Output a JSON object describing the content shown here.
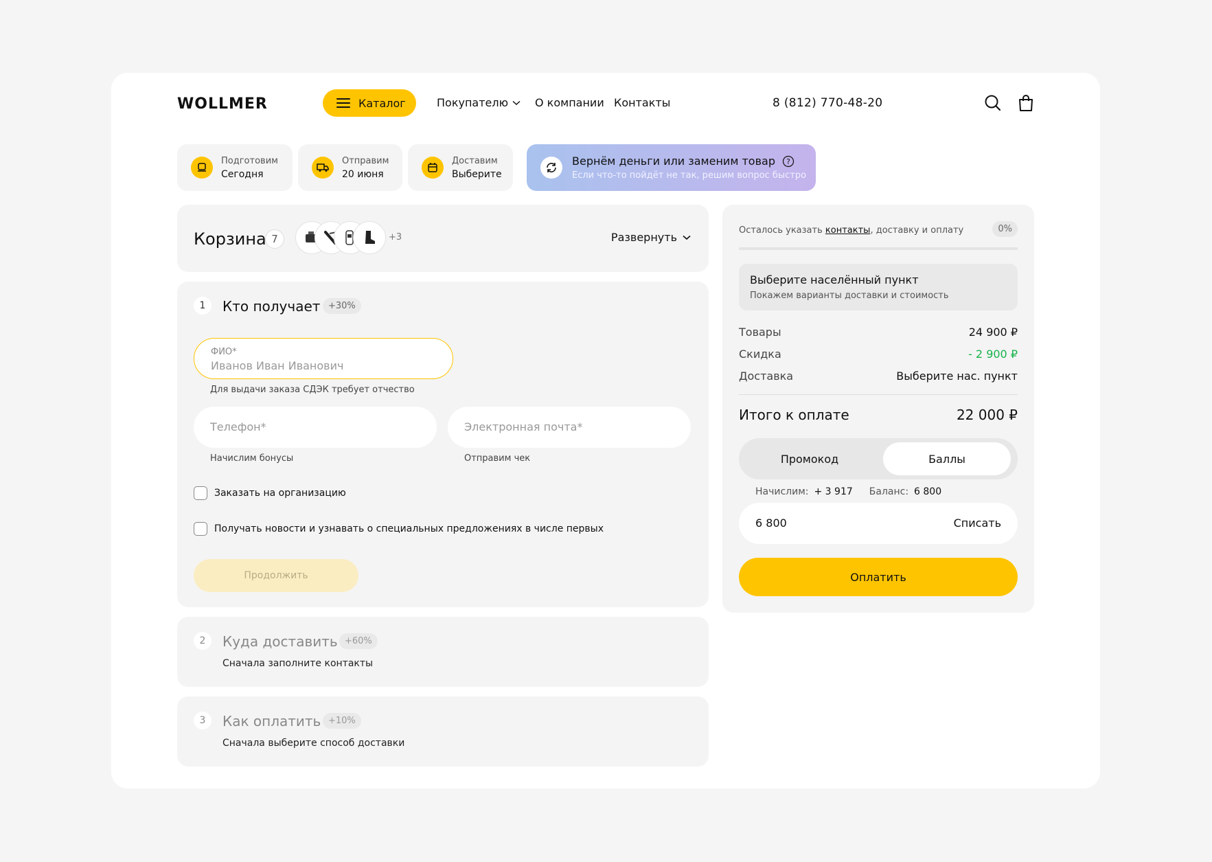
{
  "header": {
    "logo": "WOLLMER",
    "catalog_label": "Каталог",
    "nav": [
      "Покупателю",
      "О компании",
      "Контакты"
    ],
    "phone": "8 (812) 770-48-20",
    "icons": [
      "search-icon",
      "bag-icon"
    ]
  },
  "info_pills": [
    {
      "label": "Подготовим",
      "value": "Сегодня"
    },
    {
      "label": "Отправим",
      "value": "20 июня"
    },
    {
      "label": "Доставим",
      "value": "Выберите"
    }
  ],
  "refund": {
    "title": "Вернём деньги или заменим товар",
    "subtitle": "Если что-то пойдёт не так, решим вопрос быстро"
  },
  "cart": {
    "title": "Корзина",
    "count": "7",
    "more": "+3",
    "expand_label": "Развернуть"
  },
  "step1": {
    "number": "1",
    "title": "Кто получает",
    "badge": "+30%",
    "fio_label": "ФИО*",
    "fio_placeholder": "Иванов Иван Иванович",
    "fio_hint": "Для выдачи заказа СДЭК требует отчество",
    "phone_placeholder": "Телефон*",
    "phone_hint": "Начислим бонусы",
    "email_placeholder": "Электронная почта*",
    "email_hint": "Отправим чек",
    "check_org": "Заказать на организацию",
    "check_news": "Получать новости и узнавать о специальных предложениях в числе первых",
    "continue_label": "Продолжить"
  },
  "step2": {
    "number": "2",
    "title": "Куда доставить",
    "badge": "+60%",
    "subtitle": "Сначала заполните контакты"
  },
  "step3": {
    "number": "3",
    "title": "Как оплатить",
    "badge": "+10%",
    "subtitle": "Сначала выберите способ доставки"
  },
  "summary": {
    "progress_prefix": "Осталось указать ",
    "progress_link": "контакты",
    "progress_suffix": ", доставку и оплату",
    "progress_pct": "0%",
    "progress_value": 0,
    "city_title": "Выберите населённый пункт",
    "city_subtitle": "Покажем варианты доставки и стоимость",
    "goods_label": "Товары",
    "goods_value": "24 900 ₽",
    "discount_label": "Скидка",
    "discount_value": "- 2 900 ₽",
    "delivery_label": "Доставка",
    "delivery_value": "Выберите нас. пункт",
    "total_label": "Итого к оплате",
    "total_value": "22 000 ₽",
    "tab_promo": "Промокод",
    "tab_points": "Баллы",
    "accrue_label": "Начислим:",
    "accrue_value": "+ 3 917",
    "balance_label": "Баланс:",
    "balance_value": "6 800",
    "points_value": "6 800",
    "writeoff_label": "Списать",
    "pay_label": "Оплатить"
  },
  "colors": {
    "accent": "#ffc400",
    "discount": "#17b24a",
    "panel": "#f4f4f4"
  }
}
